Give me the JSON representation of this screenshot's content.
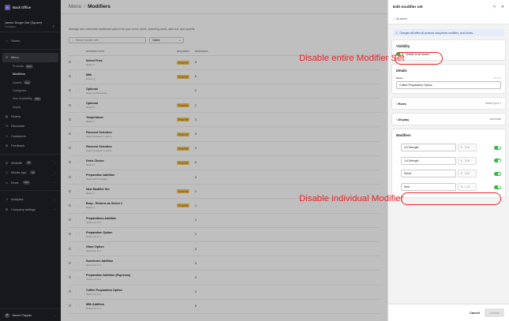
{
  "sidebar": {
    "logo_char": "B",
    "app_title": "Back Office",
    "store_name": "James' Burger Bar (Square)",
    "store_type": "Company",
    "items": [
      {
        "label": "Stores",
        "icon": "store-icon"
      },
      {
        "label": "Menu",
        "icon": "menu-icon"
      },
      {
        "label": "Orders",
        "icon": "orders-icon"
      },
      {
        "label": "Discounts",
        "icon": "discount-icon"
      },
      {
        "label": "Customers",
        "icon": "customers-icon"
      },
      {
        "label": "Feedback",
        "icon": "feedback-icon"
      },
      {
        "label": "Website",
        "icon": "website-icon",
        "badge": "40"
      },
      {
        "label": "Mobile App",
        "icon": "mobile-icon",
        "badge": "45"
      },
      {
        "label": "Kiosk",
        "icon": "kiosk-icon",
        "badge": "New"
      },
      {
        "label": "Analytics",
        "icon": "analytics-icon"
      },
      {
        "label": "Company settings",
        "icon": "settings-icon"
      }
    ],
    "menu_sub": [
      {
        "label": "Products",
        "pill": "New"
      },
      {
        "label": "Modifiers",
        "pill": ""
      },
      {
        "label": "Upsells",
        "pill": "New"
      },
      {
        "label": "Categories",
        "pill": ""
      },
      {
        "label": "Item Availability",
        "pill": "New"
      },
      {
        "label": "Import",
        "pill": ""
      }
    ],
    "user_initials": "JP",
    "user_name": "James Pappas"
  },
  "main": {
    "breadcrumb_root": "Menu",
    "breadcrumb_sep": "/",
    "breadcrumb_current": "Modifiers",
    "description": "Manage and customize additional options for your menu items, including sizes, add-ons, and upsells.",
    "search_placeholder": "Search modifier sets",
    "filter_value": "Visible",
    "columns": [
      "MODIFIER SETS",
      "REQUIRED",
      "MODIFIERS"
    ],
    "rows": [
      {
        "name": "Select Fries",
        "select": "Select 1",
        "required": "Required",
        "count": "3"
      },
      {
        "name": "Milk",
        "select": "Select 1",
        "required": "Required",
        "count": "5"
      },
      {
        "name": "Optional",
        "select": "Select all that apply",
        "required": "",
        "count": "2"
      },
      {
        "name": "Optional",
        "select": "Select 1",
        "required": "Required",
        "count": "2"
      },
      {
        "name": "Temperature",
        "select": "Select 1",
        "required": "Required",
        "count": "3"
      },
      {
        "name": "Flavored Selection",
        "select": "Select between 1 and 3",
        "required": "Required",
        "count": "3"
      },
      {
        "name": "Flavored Selection",
        "select": "Select between 1 and 3",
        "required": "Required",
        "count": "3"
      },
      {
        "name": "Drink Choice",
        "select": "Select 1",
        "required": "Required",
        "count": "6"
      },
      {
        "name": "Preparation Addition",
        "select": "Select all that apply",
        "required": "",
        "count": "3"
      },
      {
        "name": "New Modifier Set",
        "select": "Select 1",
        "required": "Required",
        "count": "2"
      },
      {
        "name": "Burp - Returns as Select 1",
        "select": "Select 1",
        "required": "Required",
        "count": "1"
      },
      {
        "name": "Preparations Addition",
        "select": "Select up to 3",
        "required": "",
        "count": "4"
      },
      {
        "name": "Preparation Option",
        "select": "Select up to 1",
        "required": "",
        "count": "1"
      },
      {
        "name": "Glaze Option",
        "select": "Select up to 1",
        "required": "",
        "count": "3"
      },
      {
        "name": "Sweetener Addition",
        "select": "Select up to 1",
        "required": "",
        "count": "4"
      },
      {
        "name": "Preparation Addition (Espresso)",
        "select": "Select up to 3",
        "required": "",
        "count": "4"
      },
      {
        "name": "Coffee Preparation Option",
        "select": "Select up to 1",
        "required": "",
        "count": "4"
      },
      {
        "name": "Milk Addition",
        "select": "Select up to 1",
        "required": "",
        "count": "6"
      }
    ]
  },
  "panel": {
    "title": "Edit modifier set",
    "stores_label": "All stores",
    "info_text": "Changes will affect all products using these modifiers, at all stores.",
    "visibility": {
      "heading": "Visibility",
      "toggle_label": "Visible at all stores",
      "on": true
    },
    "details": {
      "heading": "Details",
      "name_label": "Name",
      "name_count": "25 / 60",
      "name_value": "Coffee Preparation Option"
    },
    "rules": {
      "heading": "Rules",
      "summary": "Select up to 1"
    },
    "display": {
      "heading": "Display",
      "summary": "Automatic"
    },
    "modifiers": {
      "heading": "Modifiers",
      "currency": "$",
      "items": [
        {
          "name": "1/2 Strength",
          "price": "0.00",
          "on": true
        },
        {
          "name": "1/4 Strength",
          "price": "0.00",
          "on": true
        },
        {
          "name": "Decaf",
          "price": "0.00",
          "on": true
        },
        {
          "name": "Shot",
          "price": "1.00",
          "on": true
        }
      ]
    },
    "cancel_label": "Cancel",
    "update_label": "Update"
  },
  "annotations": {
    "top": "Disable entire Modifier Set",
    "bottom": "Disable individual Modifier",
    "color": "#e8262a"
  }
}
